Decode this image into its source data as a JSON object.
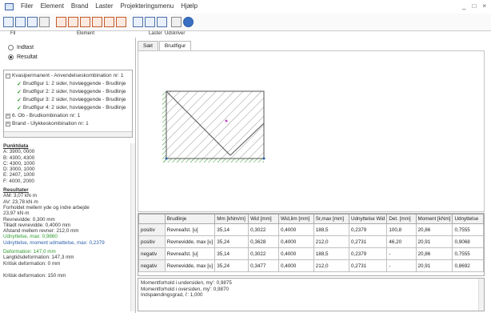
{
  "menu": {
    "items": [
      "Filer",
      "Element",
      "Brand",
      "Laster",
      "Projekteringsmenu",
      "Hjælp"
    ],
    "minimize": "_",
    "maximize": "□",
    "close": "×"
  },
  "toolbar": {
    "groups": [
      "Fil",
      "Element",
      "Laster",
      "Udskriver"
    ]
  },
  "mode": {
    "options": [
      "Indtast",
      "Resultat"
    ],
    "selected": "Resultat"
  },
  "tree": {
    "items": [
      {
        "label": "Kvasipermanent - Anvendelseskombination nr: 1",
        "type": "expanded"
      },
      {
        "label": "Brudfigur 1: 2 sider, hovlæggende - Brudlinje",
        "type": "check"
      },
      {
        "label": "Brudfigur 2: 2 sider, hovlæggende - Brudlinje",
        "type": "check"
      },
      {
        "label": "Brudfigur 3: 2 sider, hovlæggende - Brudlinje",
        "type": "check"
      },
      {
        "label": "Brudfigur 4: 2 sider, hovlæggende - Brudlinje",
        "type": "check"
      },
      {
        "label": "6. Ob - Brudkombination nr: 1",
        "type": "collapsed"
      },
      {
        "label": "Brand - Ulykkeskombination nr: 1",
        "type": "collapsed"
      }
    ]
  },
  "info": {
    "punkt_title": "Punktdata",
    "points": [
      "A: 3900, 0000",
      "B: 4300, 4300",
      "C: 4300, 1000",
      "D: 3000, 1000",
      "E: 2407, 1000",
      "F: 4000, 2000"
    ],
    "results_title": "Resultater",
    "results": [
      "AM: 3,07 kN·m",
      "AV: 23,78 kN·m",
      "Forholdet mellem yde og indre arbejde",
      "  23,97 kN·m",
      "Revnevidde: 0,300 mm",
      "Tilladt revnevidde: 0,4000 mm",
      "Afstand mellem revner: 212,0 mm",
      "Udnyttelse, max: 0,9860",
      "Udnyttelse, moment udmattelse, max: 0,2379"
    ],
    "deformation": [
      "Deformation: 147,0 mm",
      "Langtidsdeformation: 147,3 mm",
      "Kritisk deformation: 0 mm"
    ],
    "footer": "Kritisk deformation: 150 mm"
  },
  "tabs": [
    "Sæt",
    "Brudfigur"
  ],
  "table": {
    "headers": [
      "",
      "Brudlinje",
      "Mm [kNm/m]",
      "Wid [mm]",
      "Wid,lim [mm]",
      "Sr,max [mm]",
      "Udnyttelse Wid",
      "Det. [mm]",
      "Moment [kNm]",
      "Udnyttelse"
    ],
    "rows": [
      [
        "positiv",
        "Revneafst. [u]",
        "35,14",
        "0,3022",
        "0,4000",
        "188,5",
        "0,2379",
        "100,8",
        "20,86",
        "0,7555"
      ],
      [
        "positiv",
        "Revnevidde, max [u]",
        "35,24",
        "0,3628",
        "0,4000",
        "212,0",
        "0,2731",
        "46,20",
        "20,91",
        "0,9068"
      ],
      [
        "negativ",
        "Revneafst. [u]",
        "35,14",
        "0,3022",
        "0,4000",
        "188,5",
        "0,2379",
        "-",
        "20,86",
        "0,7555"
      ],
      [
        "negativ",
        "Revnevidde, max [u]",
        "35,24",
        "0,3477",
        "0,4000",
        "212,0",
        "0,2731",
        "-",
        "20,91",
        "0,8692"
      ]
    ]
  },
  "summary": {
    "lines": [
      "Momentforhold i undersiden, my': 0,9875",
      "Momentforhold i oversiden, my': 0,9870",
      "Indspændingsgrad, i': 1,000"
    ]
  }
}
